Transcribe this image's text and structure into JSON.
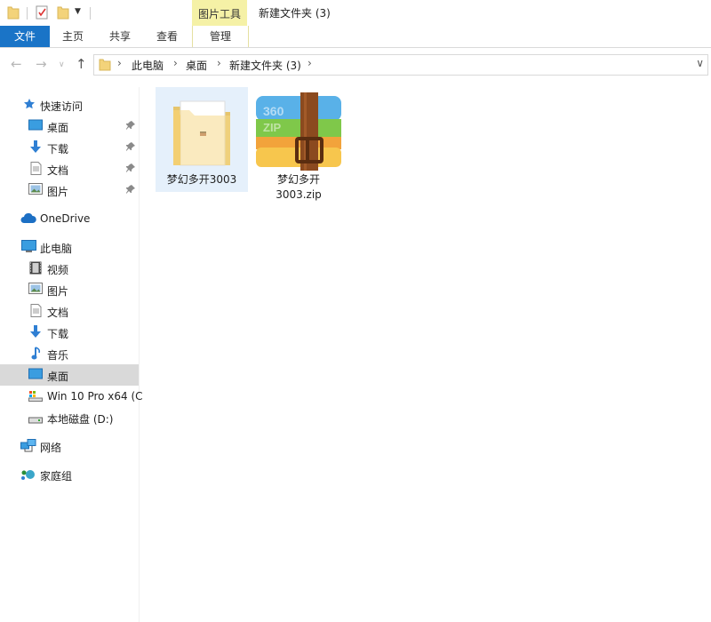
{
  "titlebar": {
    "context_tab_label": "图片工具",
    "window_title": "新建文件夹 (3)"
  },
  "ribbon": {
    "tabs": [
      {
        "label": "文件"
      },
      {
        "label": "主页"
      },
      {
        "label": "共享"
      },
      {
        "label": "查看"
      },
      {
        "label": "管理"
      }
    ]
  },
  "address": {
    "segments": [
      "此电脑",
      "桌面",
      "新建文件夹 (3)"
    ]
  },
  "sidebar": {
    "quick_access": {
      "label": "快速访问",
      "items": [
        {
          "label": "桌面",
          "icon": "desktop-icon"
        },
        {
          "label": "下载",
          "icon": "download-icon"
        },
        {
          "label": "文档",
          "icon": "document-icon"
        },
        {
          "label": "图片",
          "icon": "picture-icon"
        }
      ]
    },
    "onedrive": {
      "label": "OneDrive"
    },
    "this_pc": {
      "label": "此电脑",
      "items": [
        {
          "label": "视频",
          "icon": "video-icon"
        },
        {
          "label": "图片",
          "icon": "picture-icon"
        },
        {
          "label": "文档",
          "icon": "document-icon"
        },
        {
          "label": "下载",
          "icon": "download-icon"
        },
        {
          "label": "音乐",
          "icon": "music-icon"
        },
        {
          "label": "桌面",
          "icon": "desktop-icon"
        },
        {
          "label": "Win 10 Pro x64 (C",
          "icon": "system-drive-icon"
        },
        {
          "label": "本地磁盘 (D:)",
          "icon": "drive-icon"
        }
      ]
    },
    "network": {
      "label": "网络"
    },
    "homegroup": {
      "label": "家庭组"
    }
  },
  "files": [
    {
      "name": "梦幻多开3003",
      "type": "folder"
    },
    {
      "name_line1": "梦幻多开",
      "name_line2": "3003.zip",
      "type": "zip"
    }
  ],
  "colors": {
    "file_tab_bg": "#1a74c7",
    "context_tab_bg": "#f5f1a6",
    "selected_nav_bg": "#d9d9d9",
    "selected_file_bg": "#e5f0fb"
  }
}
